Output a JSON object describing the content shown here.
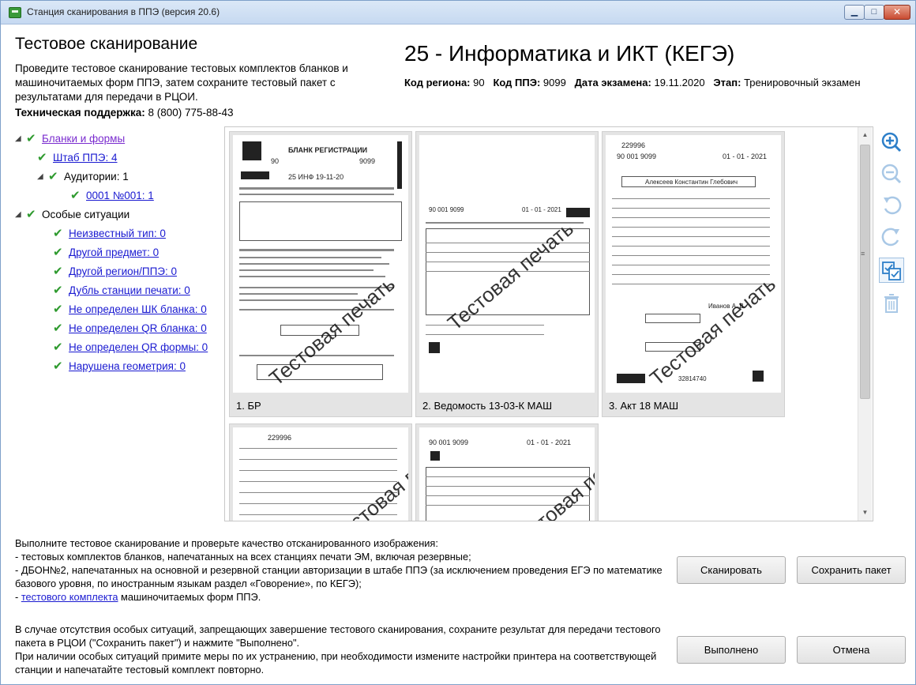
{
  "window": {
    "title": "Станция сканирования в ППЭ (версия 20.6)"
  },
  "header": {
    "page_title": "Тестовое сканирование",
    "description": "Проведите тестовое сканирование тестовых комплектов бланков и машиночитаемых форм ППЭ, затем сохраните тестовый пакет с результатами для передачи в РЦОИ.",
    "support_label": "Техническая поддержка:",
    "support_phone": "8 (800) 775-88-43",
    "subject": "25 - Информатика и ИКТ (КЕГЭ)",
    "meta": {
      "region_label": "Код региона:",
      "region_value": "90",
      "ppe_label": "Код ППЭ:",
      "ppe_value": "9099",
      "date_label": "Дата экзамена:",
      "date_value": "19.11.2020",
      "stage_label": "Этап:",
      "stage_value": "Тренировочный экзамен"
    }
  },
  "tree": {
    "forms": "Бланки и формы",
    "hq": "Штаб ППЭ: 4",
    "rooms": "Аудитории: 1",
    "room_1": "0001 №001: 1",
    "special": "Особые ситуации",
    "items": [
      "Неизвестный тип: 0",
      "Другой предмет: 0",
      "Другой регион/ППЭ: 0",
      "Дубль станции печати: 0",
      "Не определен ШК бланка: 0",
      "Не определен QR бланка: 0",
      "Не определен QR формы: 0",
      "Нарушена геометрия: 0"
    ]
  },
  "viewer": {
    "thumbnails": [
      {
        "caption": "1. БР",
        "header": "БЛАНК РЕГИСТРАЦИИ",
        "code": "90",
        "ppe": "9099",
        "date": "25 ИНФ 19-11-20"
      },
      {
        "caption": "2. Ведомость 13-03-К МАШ",
        "code": "90  001  9099",
        "date": "01 - 01 - 2021"
      },
      {
        "caption": "3. Акт 18 МАШ",
        "code": "229996",
        "row": "90  001  9099",
        "date": "01 - 01 - 2021",
        "name": "Алексеев Константин Глебович",
        "sign": "Иванов А. В.",
        "barcode": "32814740"
      },
      {
        "caption": "",
        "code": "229996"
      },
      {
        "caption": "",
        "code": "90  001  9099",
        "date": "01 - 01 - 2021"
      }
    ],
    "watermark": "Тестовая печать"
  },
  "tools": [
    "zoom-in-icon",
    "zoom-out-icon",
    "rotate-left-icon",
    "rotate-right-icon",
    "select-all-icon",
    "trash-icon"
  ],
  "instructions": {
    "line1": "Выполните тестовое сканирование и проверьте качество отсканированного изображения:",
    "line2": "- тестовых комплектов бланков, напечатанных на всех станциях печати ЭМ, включая резервные;",
    "line3": "- ДБОН№2, напечатанных на основной и резервной станции авторизации в штабе ППЭ (за исключением проведения ЕГЭ по математике базового уровня, по иностранным языкам раздел «Говорение», по КЕГЭ);",
    "line4_prefix": "- ",
    "line4_link": "тестового комплекта",
    "line4_suffix": " машиночитаемых форм ППЭ."
  },
  "note": {
    "line1": "В случае отсутствия особых ситуаций, запрещающих завершение тестового сканирования, сохраните результат для передачи тестового пакета в РЦОИ (\"Сохранить пакет\") и нажмите \"Выполнено\".",
    "line2": "При наличии особых ситуаций примите меры по их устранению, при необходимости измените настройки принтера на соответствующей станции и напечатайте тестовый комплект повторно."
  },
  "buttons": {
    "scan": "Сканировать",
    "save": "Сохранить пакет",
    "done": "Выполнено",
    "cancel": "Отмена"
  }
}
